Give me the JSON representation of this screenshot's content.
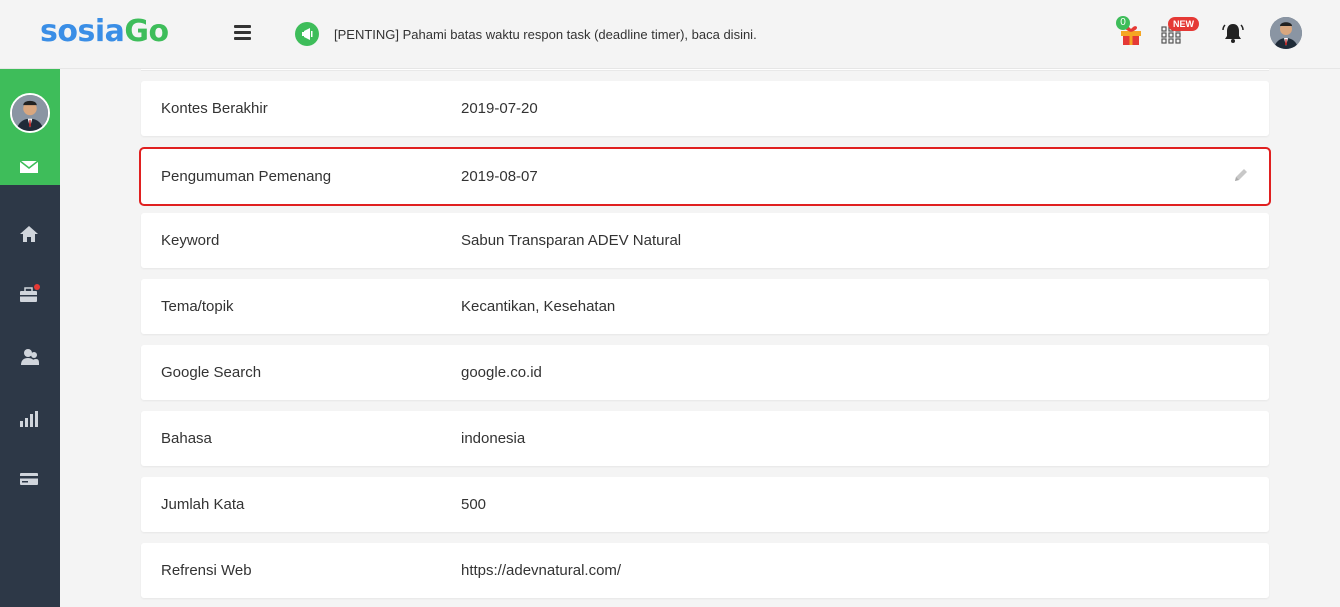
{
  "header": {
    "logo_part1": "sosia",
    "logo_part2": "Go",
    "announcement": "[PENTING] Pahami batas waktu respon task (deadline timer), baca disini.",
    "gift_count": "0",
    "new_badge": "NEW"
  },
  "details": [
    {
      "label": "Kontes Berakhir",
      "value": "2019-07-20"
    },
    {
      "label": "Pengumuman Pemenang",
      "value": "2019-08-07"
    },
    {
      "label": "Keyword",
      "value": "Sabun Transparan ADEV Natural"
    },
    {
      "label": "Tema/topik",
      "value": "Kecantikan, Kesehatan"
    },
    {
      "label": "Google Search",
      "value": "google.co.id"
    },
    {
      "label": "Bahasa",
      "value": "indonesia"
    },
    {
      "label": "Jumlah Kata",
      "value": "500"
    },
    {
      "label": "Refrensi Web",
      "value": "https://adevnatural.com/"
    }
  ],
  "colors": {
    "brand_blue": "#3a8ee6",
    "brand_green": "#3ebd5a",
    "sidebar": "#2d3847",
    "highlight": "#e02020"
  }
}
